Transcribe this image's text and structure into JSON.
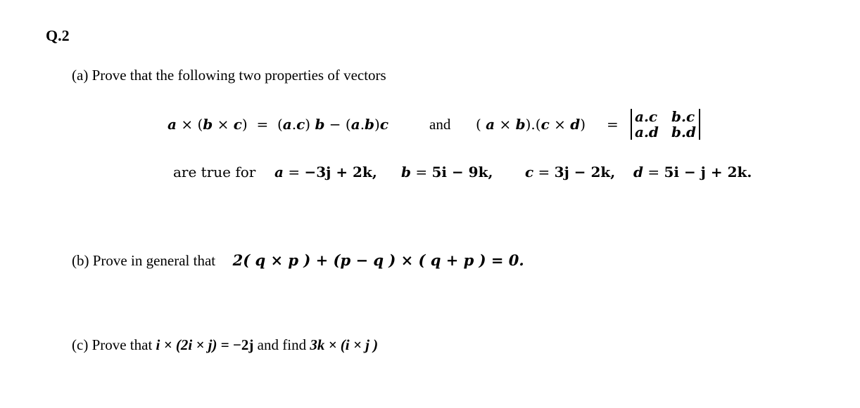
{
  "question": {
    "number": "Q.2",
    "part_a": {
      "label": "(a)",
      "intro": "Prove that the following two properties of vectors",
      "identity1": {
        "lhs": {
          "a": "a",
          "times1": "×",
          "open": "(",
          "b": "b",
          "times2": "×",
          "c": "c",
          "close": ")"
        },
        "eq": "=",
        "rhs": {
          "t1_open": "(",
          "t1_a": "a",
          "dot1": ".",
          "t1_c": "c",
          "t1_close": ")",
          "t1_b": "b",
          "minus": "−",
          "t2_open": "(",
          "t2_a": "a",
          "dot2": ".",
          "t2_b": "b",
          "t2_close": ")",
          "t2_c": "c"
        }
      },
      "connector": "and",
      "identity2": {
        "lhs": {
          "open1": "(",
          "a": "a",
          "times1": "×",
          "b": "b",
          "close1": ")",
          "dot": ".",
          "open2": "(",
          "c": "c",
          "times2": "×",
          "d": "d",
          "close2": ")"
        },
        "eq": "=",
        "determinant": [
          [
            "a.c",
            "b.c"
          ],
          [
            "a.d",
            "b.d"
          ]
        ]
      },
      "condition_text": "are true for",
      "vectors": [
        {
          "name": "a",
          "eq": "=",
          "expr": "−3j + 2k,"
        },
        {
          "name": "b",
          "eq": "=",
          "expr": "5i − 9k,"
        },
        {
          "name": "c",
          "eq": "=",
          "expr": "3j − 2k,"
        },
        {
          "name": "d",
          "eq": "=",
          "expr": "5i − j + 2k."
        }
      ]
    },
    "part_b": {
      "label": "(b)",
      "intro": "Prove in general that",
      "equation": "2( q × p ) + (p − q ) × ( q + p ) = 0."
    },
    "part_c": {
      "label": "(c)",
      "intro": "Prove that",
      "expr1": "i × (2i × j)",
      "eq": "= −2j",
      "connector": "and find",
      "expr2": "3k × (i × j )"
    }
  }
}
